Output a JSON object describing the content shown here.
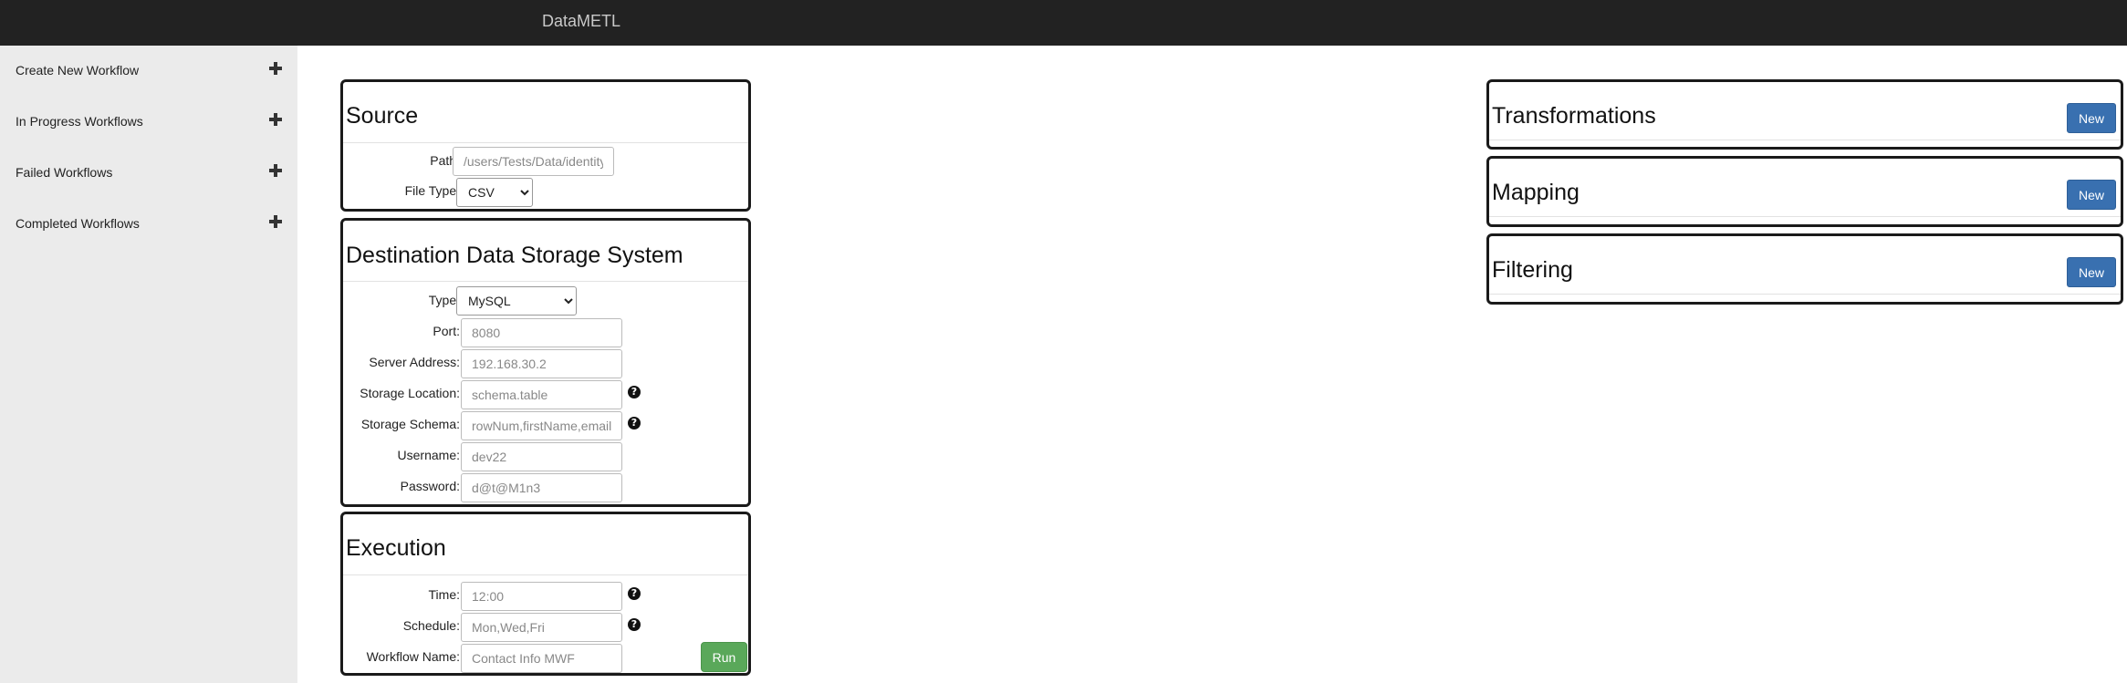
{
  "app": {
    "title": "DataMETL"
  },
  "sidebar": {
    "items": [
      {
        "label": "Create New Workflow"
      },
      {
        "label": "In Progress Workflows"
      },
      {
        "label": "Failed Workflows"
      },
      {
        "label": "Completed Workflows"
      }
    ]
  },
  "source": {
    "title": "Source",
    "path_label": "Path:",
    "path_placeholder": "/users/Tests/Data/identity.csv",
    "filetype_label": "File Type:",
    "filetype_value": "CSV"
  },
  "destination": {
    "title": "Destination Data Storage System",
    "type_label": "Type:",
    "type_value": "MySQL",
    "port_label": "Port:",
    "port_placeholder": "8080",
    "server_label": "Server Address:",
    "server_placeholder": "192.168.30.2",
    "location_label": "Storage Location:",
    "location_placeholder": "schema.table",
    "schema_label": "Storage Schema:",
    "schema_placeholder": "rowNum,firstName,email",
    "username_label": "Username:",
    "username_placeholder": "dev22",
    "password_label": "Password:",
    "password_placeholder": "d@t@M1n3"
  },
  "execution": {
    "title": "Execution",
    "time_label": "Time:",
    "time_placeholder": "12:00",
    "schedule_label": "Schedule:",
    "schedule_placeholder": "Mon,Wed,Fri",
    "name_label": "Workflow Name:",
    "name_placeholder": "Contact Info MWF",
    "run_label": "Run"
  },
  "right_panels": {
    "transformations": {
      "title": "Transformations",
      "new_label": "New"
    },
    "mapping": {
      "title": "Mapping",
      "new_label": "New"
    },
    "filtering": {
      "title": "Filtering",
      "new_label": "New"
    }
  },
  "colors": {
    "topbar": "#222222",
    "sidebar": "#ebebeb",
    "run_button": "#5aa85a",
    "new_button": "#3970b0"
  },
  "icons": {
    "plus": "plus-icon",
    "help": "question-circle-icon"
  }
}
